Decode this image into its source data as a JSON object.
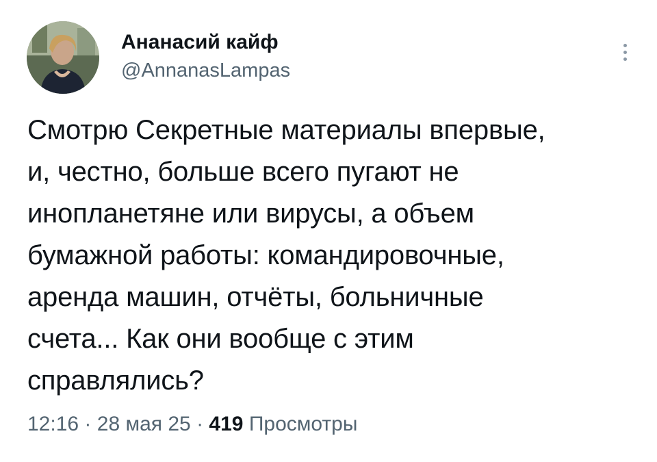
{
  "tweet": {
    "author": {
      "display_name": "Ананасий кайф",
      "handle": "@AnnanasLampas",
      "avatar_icon": "profile-photo"
    },
    "text_lines": [
      "Смотрю Секретные материалы впервые,",
      "и, честно, больше всего пугают не",
      "инопланетяне или вирусы, а объем",
      "бумажной работы: командировочные,",
      "аренда машин, отчёты, больничные",
      "счета... Как они вообще с этим",
      "справлялись?"
    ],
    "meta": {
      "time": "12:16",
      "separator": "·",
      "date": "28 мая 25",
      "views_count": "419",
      "views_label": "Просмотры"
    },
    "more_icon": "ellipsis-vertical-icon"
  },
  "colors": {
    "text_primary": "#0f1419",
    "text_secondary": "#536471",
    "background": "#ffffff"
  }
}
